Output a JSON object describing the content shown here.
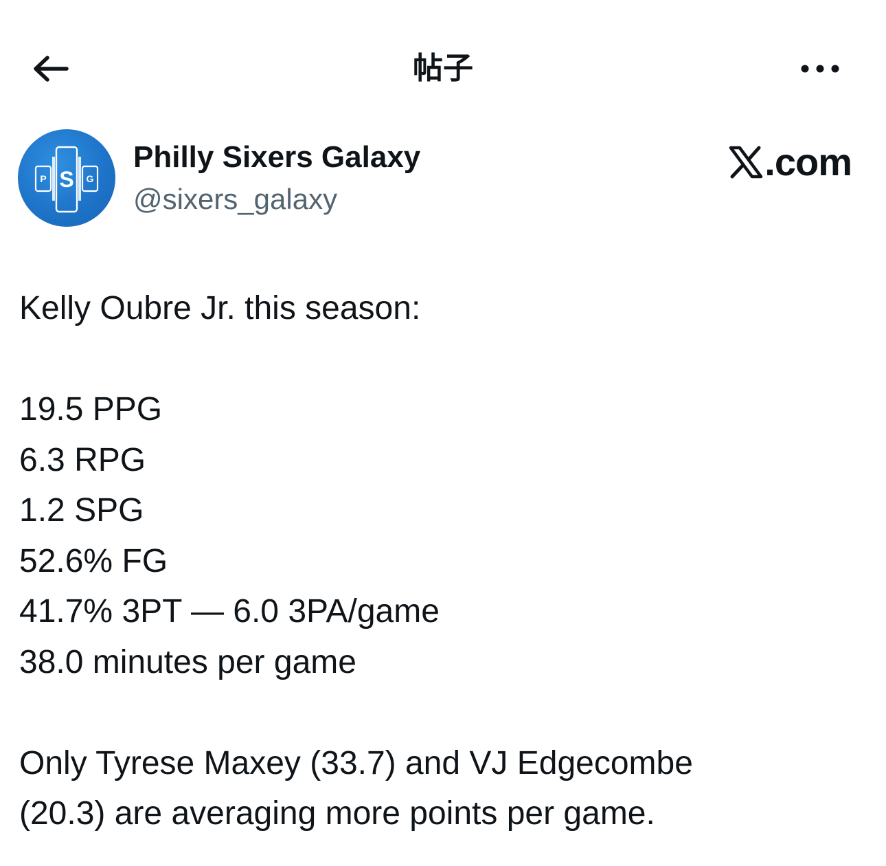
{
  "header": {
    "title": "帖子",
    "back_icon": "arrow-left-icon",
    "more_icon": "more-horizontal-icon"
  },
  "author": {
    "display_name": "Philly Sixers Galaxy",
    "handle": "@sixers_galaxy",
    "avatar": {
      "letters": [
        "P",
        "S",
        "G"
      ],
      "background_color": "#1e74c9"
    }
  },
  "watermark": {
    "logo_icon": "x-logo-icon",
    "text": ".com"
  },
  "post": {
    "lines": [
      "Kelly Oubre Jr. this season:",
      "",
      "19.5 PPG",
      "6.3 RPG",
      "1.2 SPG",
      "52.6% FG",
      "41.7% 3PT — 6.0 3PA/game",
      "38.0 minutes per game",
      "",
      "Only Tyrese Maxey (33.7) and VJ Edgecombe",
      "(20.3) are averaging more points per game."
    ]
  },
  "colors": {
    "text_primary": "#0f1419",
    "text_secondary": "#536471",
    "avatar_blue": "#1e74c9"
  }
}
